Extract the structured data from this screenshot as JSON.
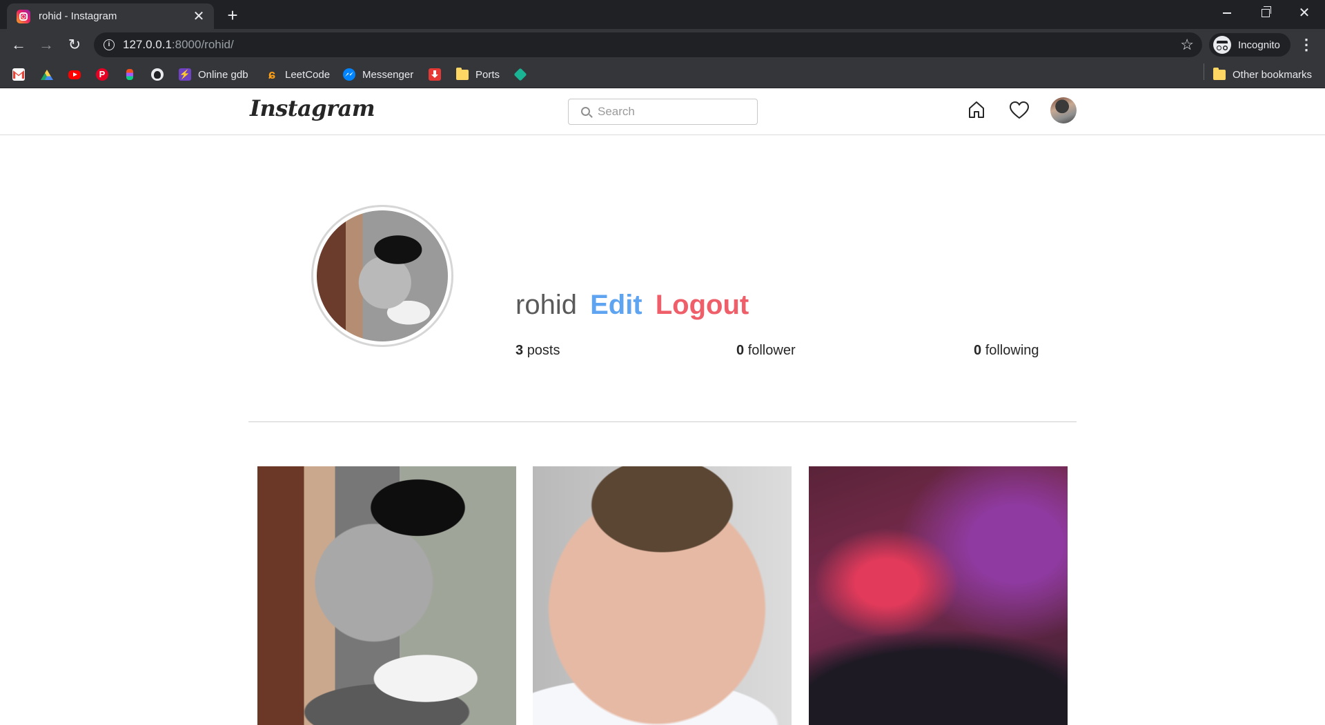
{
  "browser": {
    "tab_title": "rohid - Instagram",
    "tab_close": "✕",
    "new_tab": "+",
    "url_host": "127.0.0.1",
    "url_path": ":8000/rohid/",
    "incognito_label": "Incognito",
    "bookmarks": [
      {
        "label": "",
        "icon": "gmail-icon"
      },
      {
        "label": "",
        "icon": "google-drive-icon"
      },
      {
        "label": "",
        "icon": "youtube-icon"
      },
      {
        "label": "",
        "icon": "pinterest-icon"
      },
      {
        "label": "",
        "icon": "figma-icon"
      },
      {
        "label": "",
        "icon": "github-icon"
      },
      {
        "label": "Online gdb",
        "icon": "gdb-icon"
      },
      {
        "label": "LeetCode",
        "icon": "leetcode-icon"
      },
      {
        "label": "Messenger",
        "icon": "messenger-icon"
      },
      {
        "label": "",
        "icon": "download-icon"
      },
      {
        "label": "Ports",
        "icon": "folder-icon"
      },
      {
        "label": "",
        "icon": "diamond-icon"
      }
    ],
    "other_bookmarks": "Other bookmarks"
  },
  "header": {
    "logo": "Instagram",
    "search_placeholder": "Search"
  },
  "profile": {
    "username": "rohid",
    "edit_label": "Edit",
    "logout_label": "Logout",
    "posts_count": "3",
    "posts_label": "posts",
    "followers_count": "0",
    "followers_label": "follower",
    "following_count": "0",
    "following_label": "following"
  },
  "colors": {
    "edit": "#5fa4f0",
    "logout": "#ef5f6a",
    "chrome_dark": "#202124",
    "chrome_toolbar": "#35363a"
  }
}
